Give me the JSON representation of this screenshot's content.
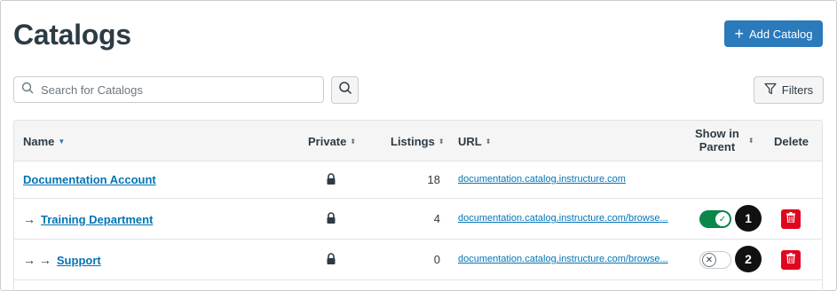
{
  "page": {
    "title": "Catalogs",
    "add_button": "Add Catalog",
    "search_placeholder": "Search for Catalogs",
    "filters_button": "Filters"
  },
  "table": {
    "headers": {
      "name": "Name",
      "private": "Private",
      "listings": "Listings",
      "url": "URL",
      "show_in_parent_line1": "Show in",
      "show_in_parent_line2": "Parent",
      "delete": "Delete"
    },
    "rows": [
      {
        "prefix": "",
        "name": "Documentation Account",
        "private": true,
        "listings": "18",
        "url": "documentation.catalog.instructure.com",
        "show_in_parent": null,
        "deletable": false
      },
      {
        "prefix": "→",
        "name": "Training Department",
        "private": true,
        "listings": "4",
        "url": "documentation.catalog.instructure.com/browse...",
        "show_in_parent": true,
        "deletable": true,
        "callout": "1"
      },
      {
        "prefix": "→ →",
        "name": "Support",
        "private": true,
        "listings": "0",
        "url": "documentation.catalog.instructure.com/browse...",
        "show_in_parent": false,
        "deletable": true,
        "callout": "2"
      }
    ]
  },
  "colors": {
    "primary": "#2b7abc",
    "link": "#0374b5",
    "toggle_on": "#0b874b",
    "delete": "#e0061f"
  }
}
